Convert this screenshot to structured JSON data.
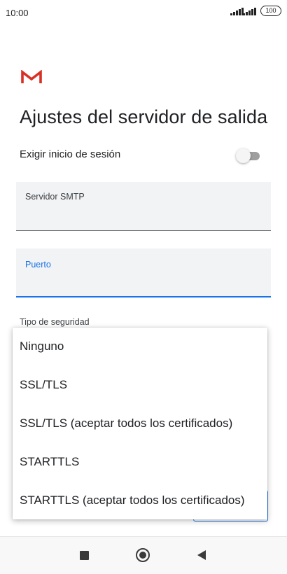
{
  "status_bar": {
    "time": "10:00",
    "battery": "100"
  },
  "app": {
    "logo_icon": "gmail-logo-icon",
    "brand_color": "#d93025",
    "accent_color": "#1a73e8"
  },
  "page": {
    "title": "Ajustes del servidor de salida"
  },
  "require_login": {
    "label": "Exigir inicio de sesión",
    "enabled": false
  },
  "fields": {
    "smtp": {
      "label": "Servidor SMTP",
      "value": ""
    },
    "port": {
      "label": "Puerto",
      "value": ""
    }
  },
  "security": {
    "label": "Tipo de seguridad",
    "options": [
      "Ninguno",
      "SSL/TLS",
      "SSL/TLS (aceptar todos los certificados)",
      "STARTTLS",
      "STARTTLS (aceptar todos los certificados)"
    ]
  },
  "nav_bar": {
    "recents_icon": "square-icon",
    "home_icon": "circle-icon",
    "back_icon": "triangle-back-icon"
  }
}
